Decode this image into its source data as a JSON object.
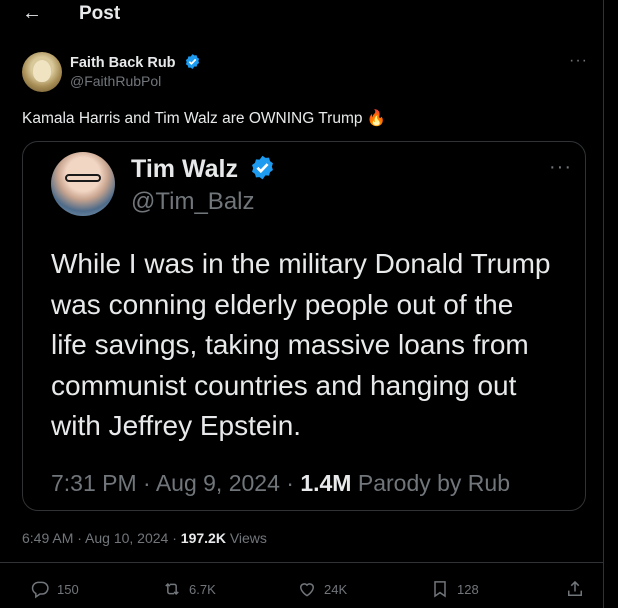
{
  "header": {
    "title": "Post"
  },
  "post": {
    "author_name": "Faith Back Rub",
    "author_handle": "@FaithRubPol",
    "text": "Kamala Harris and Tim Walz are OWNING Trump 🔥",
    "timestamp": "6:49 AM · Aug 10, 2024 · ",
    "views_count": "197.2K",
    "views_label": " Views"
  },
  "quote": {
    "author_name": "Tim Walz",
    "author_handle": "@Tim_Balz",
    "lines": [
      "While I was in the military Donald Trump",
      "was conning elderly people out of the",
      "life savings, taking massive loans from",
      "communist countries and hanging out",
      "with Jeffrey Epstein."
    ],
    "timestamp": "7:31 PM · Aug 9, 2024 · ",
    "views_count": "1.4M",
    "source": " Parody by Rub"
  },
  "actions": {
    "replies": "150",
    "reposts": "6.7K",
    "likes": "24K",
    "bookmarks": "128"
  },
  "colors": {
    "background": "#000000",
    "text": "#e7e9ea",
    "muted": "#71767b",
    "verified": "#1d9bf0",
    "border": "#2f3336"
  }
}
